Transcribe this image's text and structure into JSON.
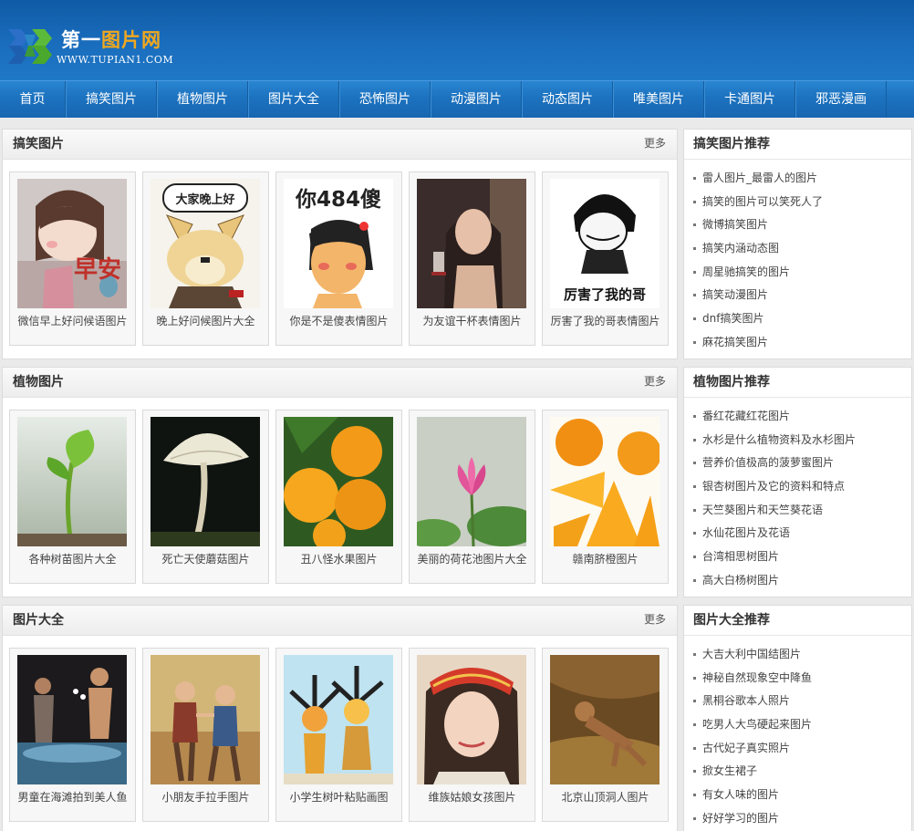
{
  "header": {
    "logo_title_a": "第一",
    "logo_title_b": "图片网",
    "logo_url": "WWW.TUPIAN1.COM"
  },
  "nav": [
    "首页",
    "搞笑图片",
    "植物图片",
    "图片大全",
    "恐怖图片",
    "动漫图片",
    "动态图片",
    "唯美图片",
    "卡通图片",
    "邪恶漫画"
  ],
  "sections": [
    {
      "title": "搞笑图片",
      "more": "更多",
      "cards": [
        {
          "caption": "微信早上好问候语图片",
          "overlay": "早安"
        },
        {
          "caption": "晚上好问候图片大全",
          "overlay": "大家晚上好"
        },
        {
          "caption": "你是不是傻表情图片",
          "overlay": "你484傻"
        },
        {
          "caption": "为友谊干杯表情图片",
          "overlay": ""
        },
        {
          "caption": "厉害了我的哥表情图片",
          "overlay": "厉害了我的哥"
        }
      ]
    },
    {
      "title": "植物图片",
      "more": "更多",
      "cards": [
        {
          "caption": "各种树苗图片大全",
          "overlay": ""
        },
        {
          "caption": "死亡天使蘑菇图片",
          "overlay": ""
        },
        {
          "caption": "丑八怪水果图片",
          "overlay": ""
        },
        {
          "caption": "美丽的荷花池图片大全",
          "overlay": ""
        },
        {
          "caption": "赣南脐橙图片",
          "overlay": ""
        }
      ]
    },
    {
      "title": "图片大全",
      "more": "更多",
      "cards": [
        {
          "caption": "男童在海滩拍到美人鱼",
          "overlay": ""
        },
        {
          "caption": "小朋友手拉手图片",
          "overlay": ""
        },
        {
          "caption": "小学生树叶粘贴画图",
          "overlay": ""
        },
        {
          "caption": "维族姑娘女孩图片",
          "overlay": ""
        },
        {
          "caption": "北京山顶洞人图片",
          "overlay": ""
        }
      ]
    }
  ],
  "sidebars": [
    {
      "title": "搞笑图片推荐",
      "items": [
        "雷人图片_最雷人的图片",
        "搞笑的图片可以笑死人了",
        "微博搞笑图片",
        "搞笑内涵动态图",
        "周星驰搞笑的图片",
        "搞笑动漫图片",
        "dnf搞笑图片",
        "麻花搞笑图片"
      ]
    },
    {
      "title": "植物图片推荐",
      "items": [
        "番红花藏红花图片",
        "水杉是什么植物资料及水杉图片",
        "营养价值极高的菠萝蜜图片",
        "银杏树图片及它的资料和特点",
        "天竺葵图片和天竺葵花语",
        "水仙花图片及花语",
        "台湾相思树图片",
        "高大白杨树图片"
      ]
    },
    {
      "title": "图片大全推荐",
      "items": [
        "大吉大利中国结图片",
        "神秘自然现象空中降鱼",
        "黑桐谷歌本人照片",
        "吃男人大鸟硬起来图片",
        "古代妃子真实照片",
        "掀女生裙子",
        "有女人味的图片",
        "好好学习的图片"
      ]
    }
  ]
}
